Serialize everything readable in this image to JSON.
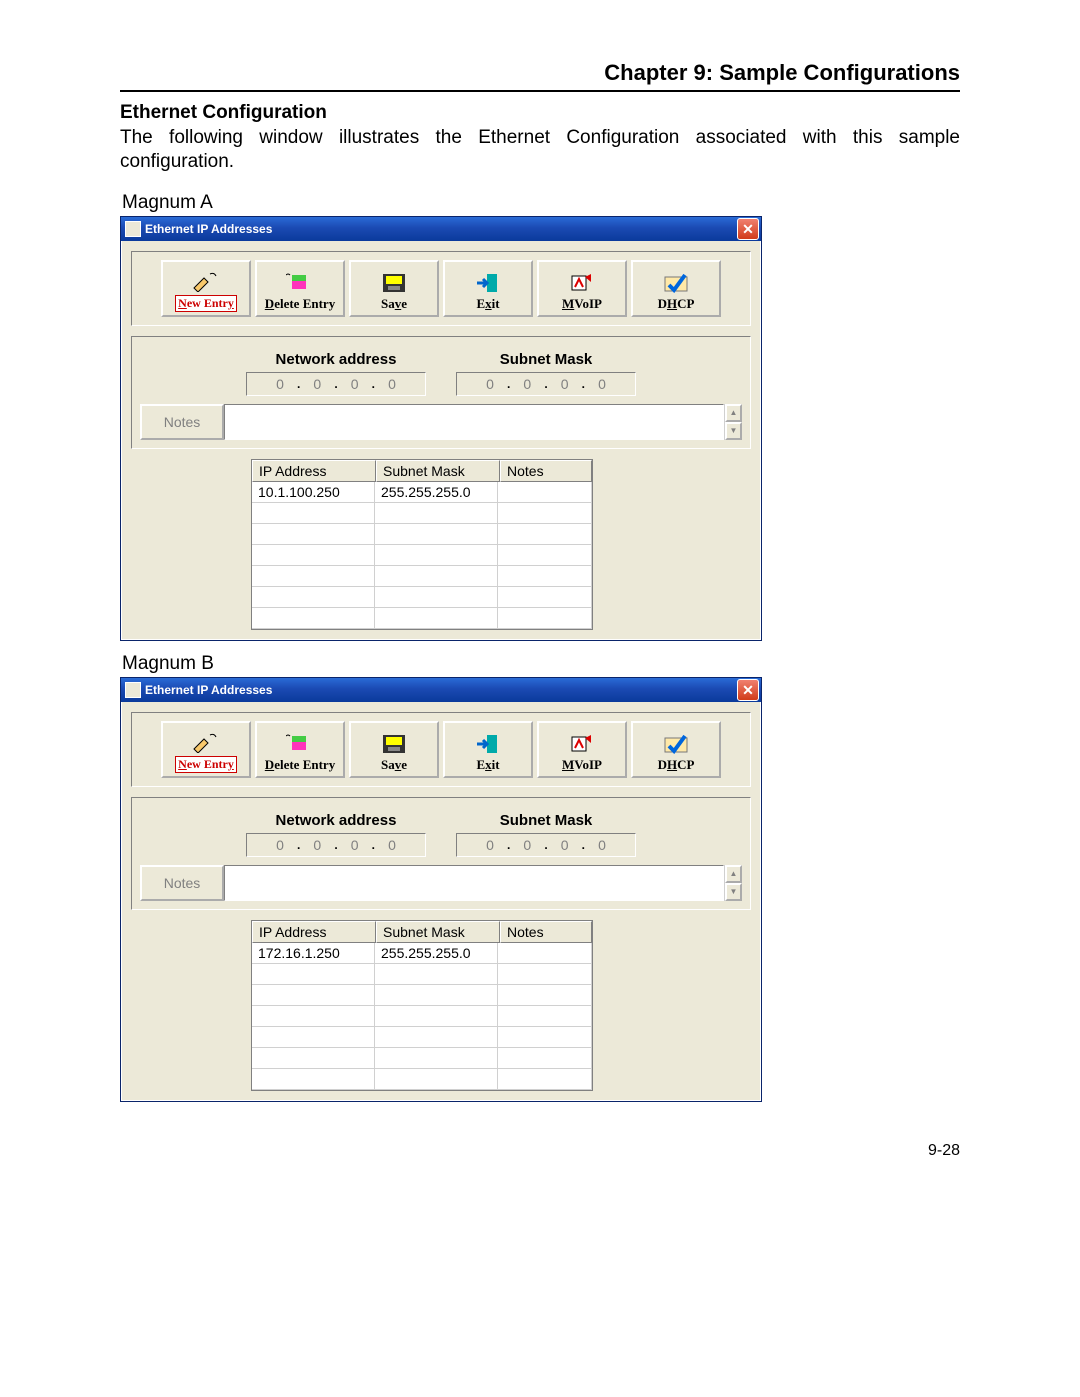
{
  "header": {
    "chapter_title": "Chapter 9: Sample Configurations",
    "section_title": "Ethernet Configuration",
    "body": "The following window illustrates the Ethernet Configuration associated with this sample configuration."
  },
  "page_number": "9-28",
  "toolbar": {
    "new_entry": "New Entry",
    "delete_entry": "Delete Entry",
    "save": "Save",
    "exit": "Exit",
    "mvoip": "MVoIP",
    "dhcp": "DHCP"
  },
  "common": {
    "window_title": "Ethernet IP Addresses",
    "network_address_label": "Network address",
    "subnet_mask_label": "Subnet Mask",
    "notes_label": "Notes",
    "ip_octet_placeholder": "0",
    "grid_headers": {
      "ip": "IP Address",
      "mask": "Subnet Mask",
      "notes": "Notes"
    }
  },
  "figures": [
    {
      "label": "Magnum A",
      "rows": [
        {
          "ip": "10.1.100.250",
          "mask": "255.255.255.0",
          "notes": ""
        }
      ]
    },
    {
      "label": "Magnum B",
      "rows": [
        {
          "ip": "172.16.1.250",
          "mask": "255.255.255.0",
          "notes": ""
        }
      ]
    }
  ]
}
